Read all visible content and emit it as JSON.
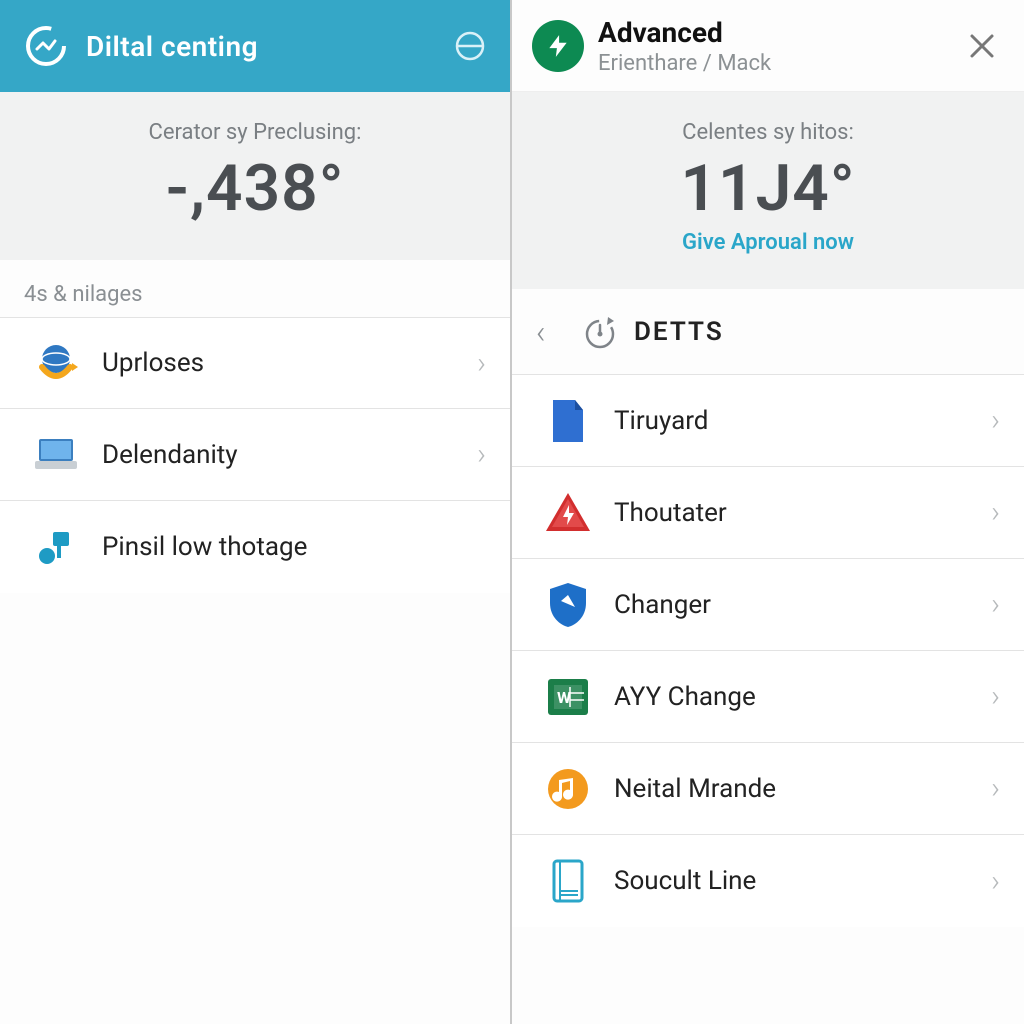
{
  "left": {
    "header": {
      "title": "Diltal centing"
    },
    "metric": {
      "caption": "Cerator sy Preclusing:",
      "value": "-,438°"
    },
    "section_label": "4s & nilages",
    "items": [
      {
        "label": "Uprloses",
        "icon": "globe-arrow-icon",
        "chevron": true
      },
      {
        "label": "Delendanity",
        "icon": "laptop-icon",
        "chevron": true
      },
      {
        "label": "Pinsil low thotage",
        "icon": "tool-icon",
        "chevron": false
      }
    ]
  },
  "right": {
    "header": {
      "title": "Advanced",
      "subtitle": "Erienthare / Mack",
      "badge_icon": "bolt-icon"
    },
    "metric": {
      "caption": "Celentes sy hitos:",
      "value": "11J4°",
      "cta": "Give Aproual now"
    },
    "section": {
      "heading": "DETTS"
    },
    "items": [
      {
        "label": "Tiruyard",
        "icon": "doc-blue-icon"
      },
      {
        "label": "Thoutater",
        "icon": "triangle-red-icon"
      },
      {
        "label": "Changer",
        "icon": "shield-blue-icon"
      },
      {
        "label": "AYY Change",
        "icon": "sheet-green-icon"
      },
      {
        "label": "Neital Mrande",
        "icon": "music-orange-icon"
      },
      {
        "label": "Soucult Line",
        "icon": "book-outline-icon"
      }
    ]
  },
  "colors": {
    "header_bg": "#35a7c7",
    "accent": "#2aa6c9",
    "badge_bg": "#0d8a52"
  }
}
